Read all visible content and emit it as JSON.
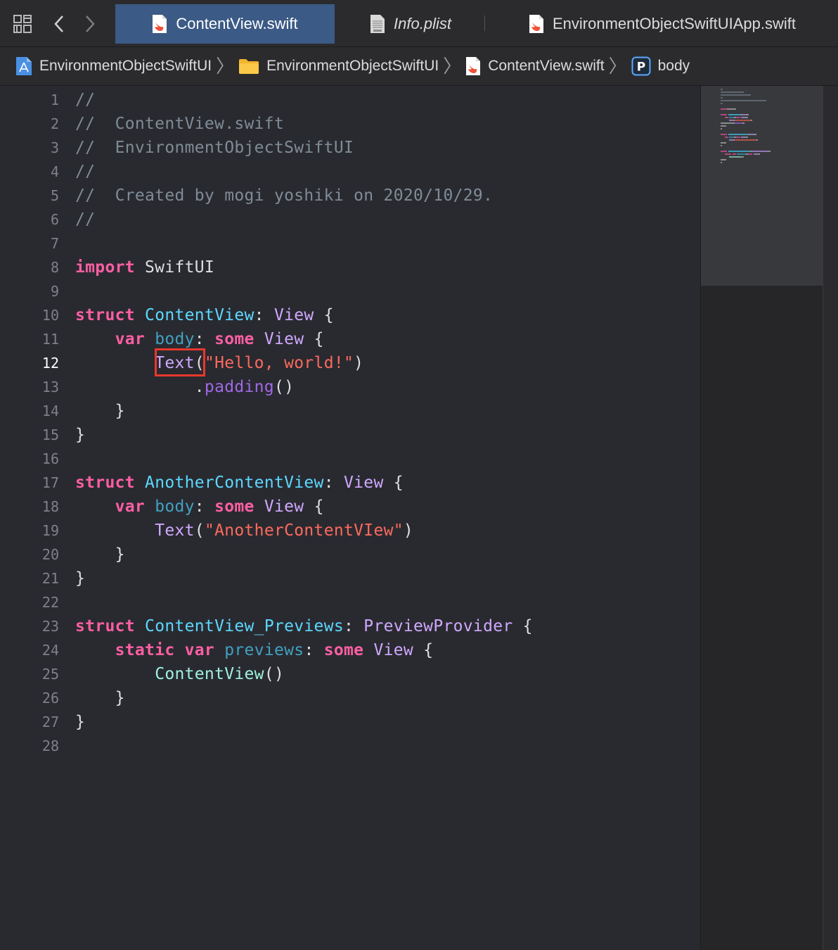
{
  "tabs": [
    {
      "label": "ContentView.swift",
      "icon": "swift-file-icon",
      "active": true
    },
    {
      "label": "Info.plist",
      "icon": "plist-file-icon",
      "active": false
    },
    {
      "label": "EnvironmentObjectSwiftUIApp.swift",
      "icon": "swift-file-icon",
      "active": false
    }
  ],
  "breadcrumb": [
    {
      "label": "EnvironmentObjectSwiftUI",
      "icon": "xcode-project-icon"
    },
    {
      "label": "EnvironmentObjectSwiftUI",
      "icon": "folder-icon"
    },
    {
      "label": "ContentView.swift",
      "icon": "swift-file-icon"
    },
    {
      "label": "body",
      "icon": "property-icon",
      "icon_letter": "P"
    }
  ],
  "editor": {
    "current_line": 12,
    "line_numbers": [
      "1",
      "2",
      "3",
      "4",
      "5",
      "6",
      "7",
      "8",
      "9",
      "10",
      "11",
      "12",
      "13",
      "14",
      "15",
      "16",
      "17",
      "18",
      "19",
      "20",
      "21",
      "22",
      "23",
      "24",
      "25",
      "26",
      "27",
      "28"
    ],
    "lines": [
      [
        [
          "cm",
          "//"
        ]
      ],
      [
        [
          "cm",
          "//  ContentView.swift"
        ]
      ],
      [
        [
          "cm",
          "//  EnvironmentObjectSwiftUI"
        ]
      ],
      [
        [
          "cm",
          "//"
        ]
      ],
      [
        [
          "cm",
          "//  Created by mogi yoshiki on 2020/10/29."
        ]
      ],
      [
        [
          "cm",
          "//"
        ]
      ],
      [],
      [
        [
          "kw",
          "import"
        ],
        [
          "pl",
          " SwiftUI"
        ]
      ],
      [],
      [
        [
          "kw",
          "struct"
        ],
        [
          "pl",
          " "
        ],
        [
          "ty",
          "ContentView"
        ],
        [
          "pl",
          ": "
        ],
        [
          "sys",
          "View"
        ],
        [
          "pl",
          " {"
        ]
      ],
      [
        [
          "pl",
          "    "
        ],
        [
          "kw",
          "var"
        ],
        [
          "pl",
          " "
        ],
        [
          "prop",
          "body"
        ],
        [
          "pl",
          ": "
        ],
        [
          "kw",
          "some"
        ],
        [
          "pl",
          " "
        ],
        [
          "sys",
          "View"
        ],
        [
          "pl",
          " {"
        ]
      ],
      [
        [
          "pl",
          "        "
        ],
        [
          "sys",
          "Text"
        ],
        [
          "pl",
          "("
        ],
        [
          "str",
          "\"Hello, world!\""
        ],
        [
          "pl",
          ")"
        ]
      ],
      [
        [
          "pl",
          "            ."
        ],
        [
          "sysc",
          "padding"
        ],
        [
          "pl",
          "()"
        ]
      ],
      [
        [
          "pl",
          "    }"
        ]
      ],
      [
        [
          "pl",
          "}"
        ]
      ],
      [],
      [
        [
          "kw",
          "struct"
        ],
        [
          "pl",
          " "
        ],
        [
          "ty",
          "AnotherContentView"
        ],
        [
          "pl",
          ": "
        ],
        [
          "sys",
          "View"
        ],
        [
          "pl",
          " {"
        ]
      ],
      [
        [
          "pl",
          "    "
        ],
        [
          "kw",
          "var"
        ],
        [
          "pl",
          " "
        ],
        [
          "prop",
          "body"
        ],
        [
          "pl",
          ": "
        ],
        [
          "kw",
          "some"
        ],
        [
          "pl",
          " "
        ],
        [
          "sys",
          "View"
        ],
        [
          "pl",
          " {"
        ]
      ],
      [
        [
          "pl",
          "        "
        ],
        [
          "sys",
          "Text"
        ],
        [
          "pl",
          "("
        ],
        [
          "str",
          "\"AnotherContentVIew\""
        ],
        [
          "pl",
          ")"
        ]
      ],
      [
        [
          "pl",
          "    }"
        ]
      ],
      [
        [
          "pl",
          "}"
        ]
      ],
      [],
      [
        [
          "kw",
          "struct"
        ],
        [
          "pl",
          " "
        ],
        [
          "ty",
          "ContentView_Previews"
        ],
        [
          "pl",
          ": "
        ],
        [
          "sys",
          "PreviewProvider"
        ],
        [
          "pl",
          " {"
        ]
      ],
      [
        [
          "pl",
          "    "
        ],
        [
          "kw",
          "static"
        ],
        [
          "pl",
          " "
        ],
        [
          "kw",
          "var"
        ],
        [
          "pl",
          " "
        ],
        [
          "prop",
          "previews"
        ],
        [
          "pl",
          ": "
        ],
        [
          "kw",
          "some"
        ],
        [
          "pl",
          " "
        ],
        [
          "sys",
          "View"
        ],
        [
          "pl",
          " {"
        ]
      ],
      [
        [
          "pl",
          "        "
        ],
        [
          "tc",
          "ContentView"
        ],
        [
          "pl",
          "()"
        ]
      ],
      [
        [
          "pl",
          "    }"
        ]
      ],
      [
        [
          "pl",
          "}"
        ]
      ],
      []
    ]
  },
  "colors": {
    "background": "#292a30",
    "comment": "#7f8c98",
    "keyword": "#fc5fa3",
    "type_declaration": "#5dd8ff",
    "system_type": "#d0a8ff",
    "string": "#fc6a5d",
    "project_type": "#9ef1dd",
    "active_tab": "#3b5a85",
    "highlight_box": "#e8382b"
  }
}
